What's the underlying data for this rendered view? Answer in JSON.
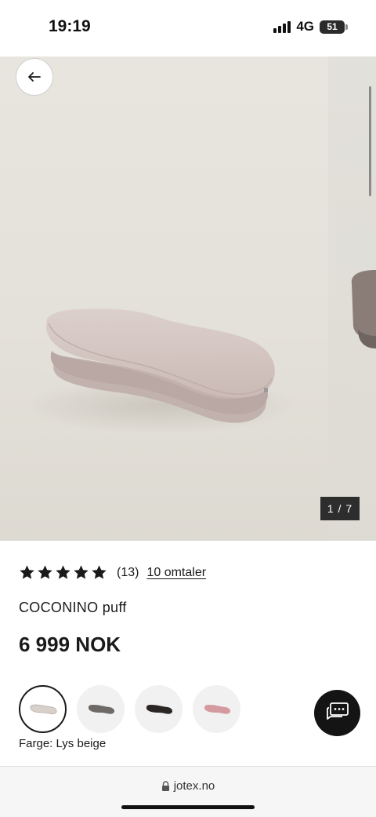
{
  "status_bar": {
    "time": "19:19",
    "network": "4G",
    "battery": "51"
  },
  "gallery": {
    "counter": "1 / 7",
    "back_icon": "arrow-left-icon"
  },
  "product": {
    "rating_value": 5,
    "rating_count": "(13)",
    "reviews_link": "10 omtaler",
    "name": "COCONINO puff",
    "price": "6 999 NOK",
    "color_label": "Farge: Lys beige",
    "swatches": [
      {
        "name": "Lys beige",
        "color": "#d8d0cb",
        "selected": true
      },
      {
        "name": "Grå",
        "color": "#6e6a67",
        "selected": false
      },
      {
        "name": "Mørk",
        "color": "#2a2624",
        "selected": false
      },
      {
        "name": "Rosa",
        "color": "#d59a9f",
        "selected": false
      }
    ]
  },
  "chat": {
    "icon": "chat-bubble-icon"
  },
  "browser": {
    "url": "jotex.no",
    "lock_icon": "lock-icon"
  },
  "colors": {
    "star": "#1a1a1a",
    "counter_bg": "#2d2d2d",
    "chat_bg": "#141414",
    "pouf": "#d7c9c5"
  }
}
